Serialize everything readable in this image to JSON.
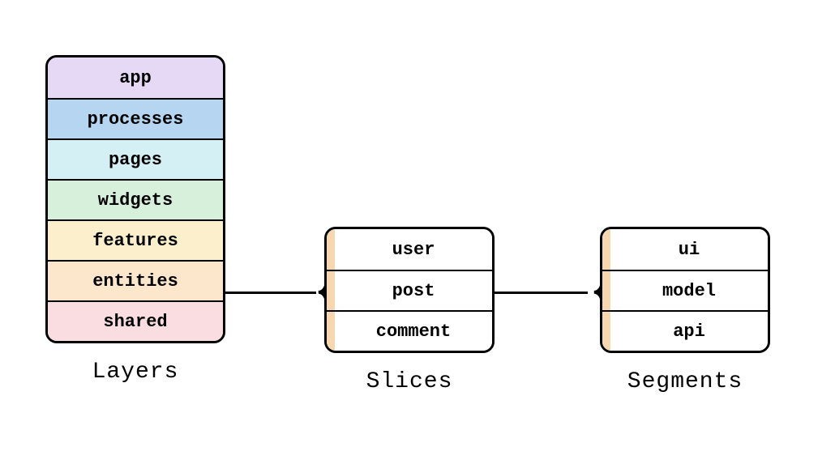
{
  "columns": {
    "layers": {
      "caption": "Layers",
      "items": [
        {
          "label": "app",
          "colorClass": "c-purple"
        },
        {
          "label": "processes",
          "colorClass": "c-blue"
        },
        {
          "label": "pages",
          "colorClass": "c-lightblue"
        },
        {
          "label": "widgets",
          "colorClass": "c-green"
        },
        {
          "label": "features",
          "colorClass": "c-yellow"
        },
        {
          "label": "entities",
          "colorClass": "c-orange-light"
        },
        {
          "label": "shared",
          "colorClass": "c-pink"
        }
      ]
    },
    "slices": {
      "caption": "Slices",
      "items": [
        {
          "label": "user"
        },
        {
          "label": "post"
        },
        {
          "label": "comment"
        }
      ]
    },
    "segments": {
      "caption": "Segments",
      "items": [
        {
          "label": "ui"
        },
        {
          "label": "model"
        },
        {
          "label": "api"
        }
      ]
    }
  }
}
